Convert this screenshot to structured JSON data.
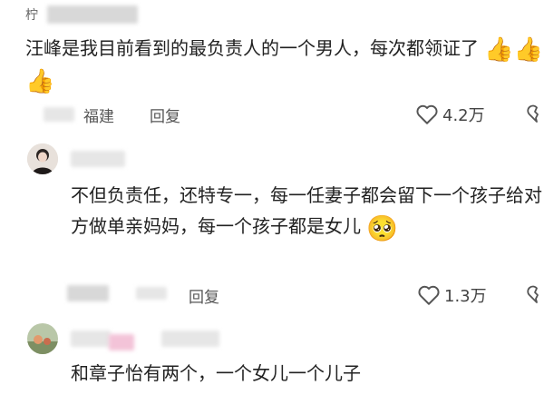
{
  "comment1": {
    "author": "柠",
    "text": "汪峰是我目前看到的最负责人的一个男人，每次都领证了",
    "emojis": [
      "👍",
      "👍",
      "👍"
    ],
    "location": "福建",
    "reply_label": "回复",
    "likes": "4.2万"
  },
  "reply1": {
    "text": "不但负责任，还特专一，每一任妻子都会留下一个孩子给对方做单亲妈妈，每一个孩子都是女儿",
    "emoji": "🥺",
    "reply_label": "回复",
    "likes": "1.3万"
  },
  "reply2": {
    "text": "和章子怡有两个，一个女儿一个儿子"
  },
  "icons": {
    "like": "heart-outline-icon",
    "dislike": "heart-broken-icon"
  }
}
